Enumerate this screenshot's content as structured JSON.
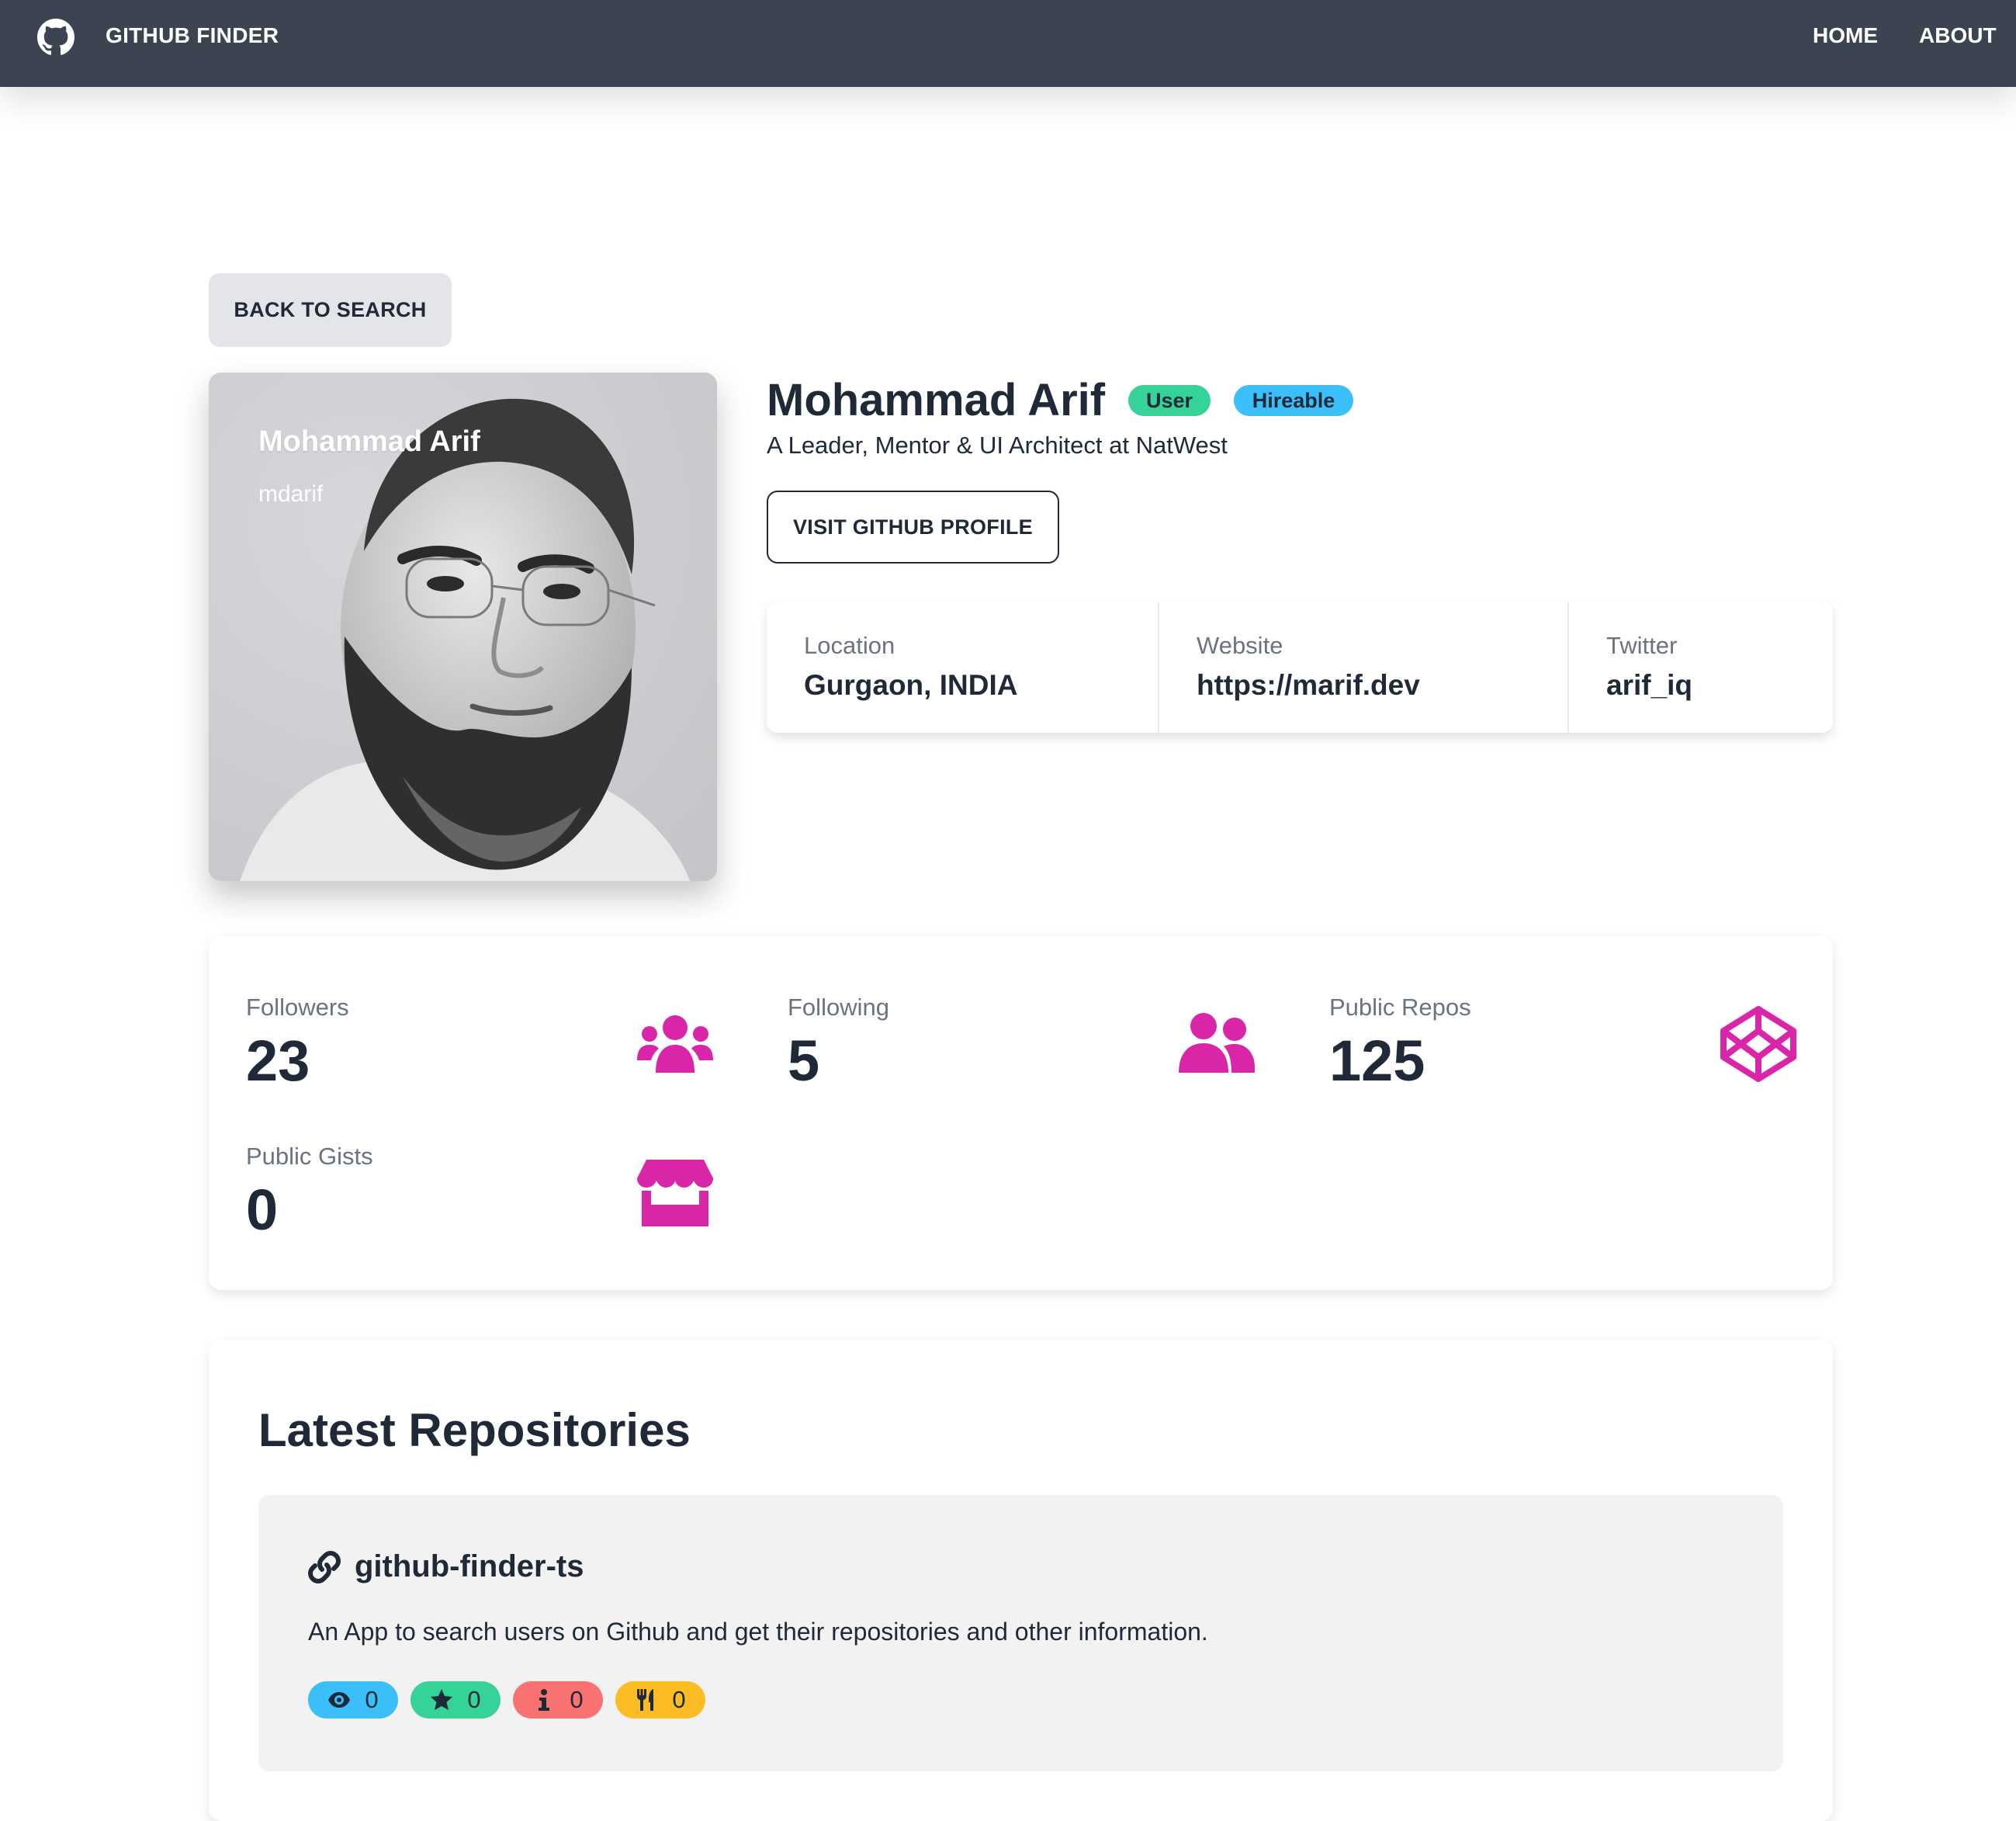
{
  "navbar": {
    "brand": "GITHUB FINDER",
    "logo_icon": "github-icon",
    "links": {
      "home": "HOME",
      "about": "ABOUT"
    },
    "background": "#3d4451"
  },
  "back_button": {
    "label": "BACK TO SEARCH"
  },
  "avatar": {
    "name": "Mohammad Arif",
    "login": "mdarif"
  },
  "profile": {
    "name": "Mohammad Arif",
    "badges": {
      "type": "User",
      "hireable": "Hireable"
    },
    "bio": "A Leader, Mentor & UI Architect at NatWest",
    "visit_button": "VISIT GITHUB PROFILE",
    "details": {
      "location": {
        "label": "Location",
        "value": "Gurgaon, INDIA"
      },
      "website": {
        "label": "Website",
        "value": "https://marif.dev"
      },
      "twitter": {
        "label": "Twitter",
        "value": "arif_iq"
      }
    }
  },
  "counts": {
    "followers": {
      "label": "Followers",
      "value": "23",
      "icon": "users-icon"
    },
    "following": {
      "label": "Following",
      "value": "5",
      "icon": "user-friends-icon"
    },
    "public_repos": {
      "label": "Public Repos",
      "value": "125",
      "icon": "codepen-icon"
    },
    "public_gists": {
      "label": "Public Gists",
      "value": "0",
      "icon": "store-icon"
    },
    "icon_color": "#d926a9"
  },
  "repos": {
    "title": "Latest Repositories",
    "items": [
      {
        "name": "github-finder-ts",
        "description": "An App to search users on Github and get their repositories and other information.",
        "watchers": "0",
        "stars": "0",
        "issues": "0",
        "forks": "0"
      }
    ]
  },
  "colors": {
    "accent": "#d926a9",
    "badge_info": "#3abff8",
    "badge_success": "#36d399",
    "badge_error": "#f87272",
    "badge_warning": "#fbbd23"
  }
}
